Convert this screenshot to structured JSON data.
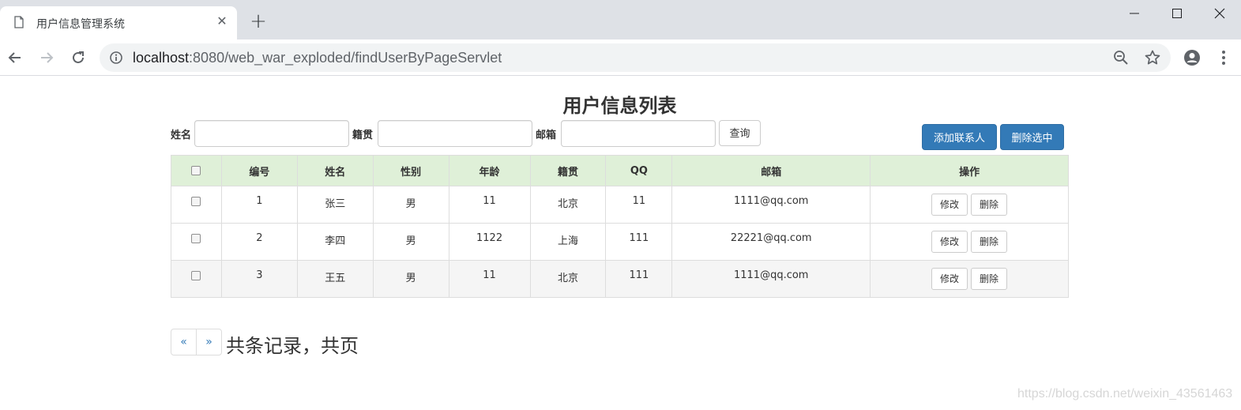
{
  "browser": {
    "tab_title": "用户信息管理系统",
    "url_host": "localhost",
    "url_rest": ":8080/web_war_exploded/findUserByPageServlet",
    "icons": [
      "page-icon",
      "close-icon",
      "plus-icon",
      "minimize-icon",
      "maximize-icon",
      "window-close-icon",
      "back-icon",
      "forward-icon",
      "reload-icon",
      "info-icon",
      "zoom-out-icon",
      "star-icon",
      "account-icon",
      "menu-icon"
    ]
  },
  "page": {
    "title": "用户信息列表",
    "search": {
      "name_label": "姓名",
      "address_label": "籍贯",
      "email_label": "邮箱",
      "name_value": "",
      "address_value": "",
      "email_value": "",
      "query_button": "查询"
    },
    "actions": {
      "add": "添加联系人",
      "delete_selected": "删除选中"
    },
    "table": {
      "columns": [
        "",
        "编号",
        "姓名",
        "性别",
        "年龄",
        "籍贯",
        "QQ",
        "邮箱",
        "操作"
      ],
      "rows": [
        {
          "id": "1",
          "name": "张三",
          "gender": "男",
          "age": "11",
          "address": "北京",
          "qq": "11",
          "email": "1111@qq.com"
        },
        {
          "id": "2",
          "name": "李四",
          "gender": "男",
          "age": "1122",
          "address": "上海",
          "qq": "111",
          "email": "22221@qq.com"
        },
        {
          "id": "3",
          "name": "王五",
          "gender": "男",
          "age": "11",
          "address": "北京",
          "qq": "111",
          "email": "1111@qq.com"
        }
      ],
      "edit_label": "修改",
      "delete_label": "删除"
    },
    "pagination": {
      "prev": "«",
      "next": "»",
      "summary": "共条记录，共页"
    },
    "watermark": "https://blog.csdn.net/weixin_43561463"
  },
  "colors": {
    "header_row": "#dff0d8",
    "primary": "#337ab7",
    "chrome_bg": "#dee1e6"
  }
}
